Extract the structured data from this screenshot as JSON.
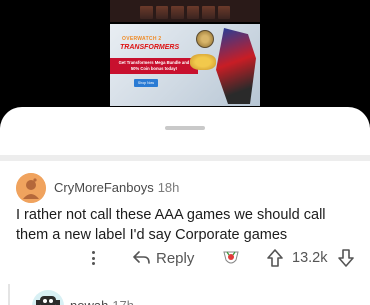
{
  "ad": {
    "logo": "OVERWATCH 2",
    "brand": "TRANSFORMERS",
    "promo": "Get Transformers Mega Bundle and 50% Coin bonus today!",
    "cta": "Shop Now"
  },
  "comment": {
    "username": "CryMoreFanboys",
    "age": "18h",
    "body": "I rather not call these AAA games we should call them a new label I'd say Corporate games",
    "reply_label": "Reply",
    "votes": "13.2k"
  },
  "child": {
    "username": "nowah",
    "age": "17h"
  },
  "colors": {
    "sheet": "#ffffff",
    "text": "#1c1c1c",
    "muted": "#555555",
    "avatar": "#f0a35e"
  }
}
